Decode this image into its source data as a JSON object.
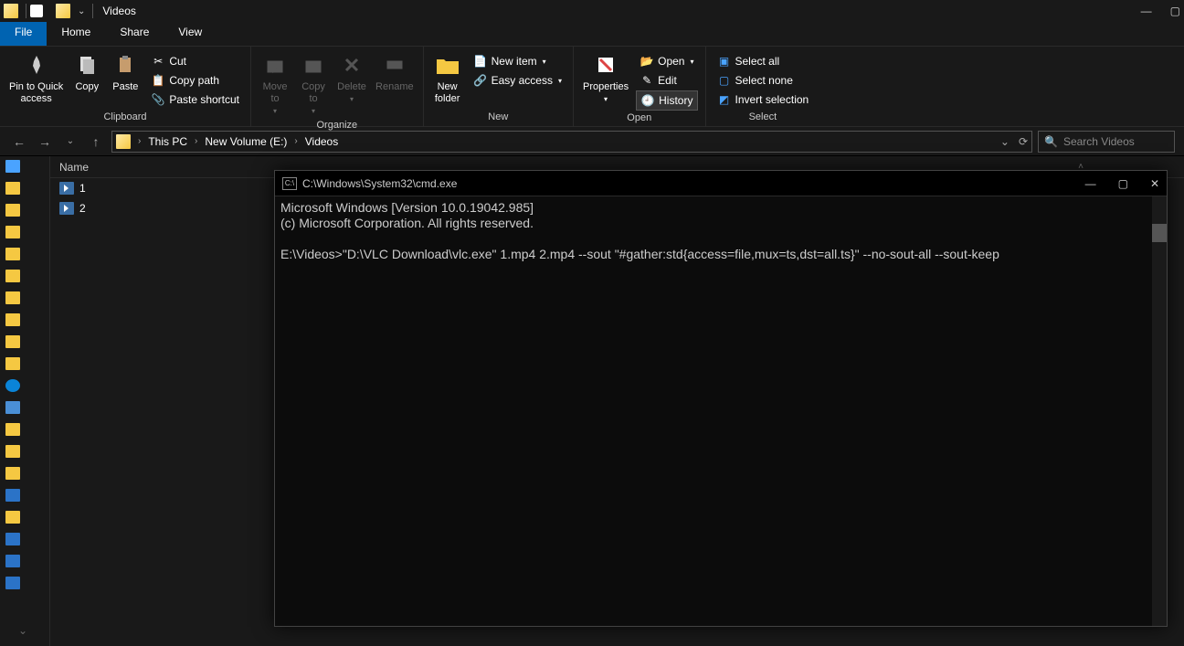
{
  "titlebar": {
    "window_title": "Videos"
  },
  "window_controls": {
    "minimize": "—",
    "maximize": "▢"
  },
  "tabs": {
    "file": "File",
    "home": "Home",
    "share": "Share",
    "view": "View"
  },
  "ribbon": {
    "clipboard": {
      "group_label": "Clipboard",
      "pin": "Pin to Quick\naccess",
      "copy": "Copy",
      "paste": "Paste",
      "cut": "Cut",
      "copy_path": "Copy path",
      "paste_shortcut": "Paste shortcut"
    },
    "organize": {
      "group_label": "Organize",
      "move_to": "Move\nto",
      "copy_to": "Copy\nto",
      "delete": "Delete",
      "rename": "Rename"
    },
    "new": {
      "group_label": "New",
      "new_folder": "New\nfolder",
      "new_item": "New item",
      "easy_access": "Easy access"
    },
    "open": {
      "group_label": "Open",
      "properties": "Properties",
      "open": "Open",
      "edit": "Edit",
      "history": "History"
    },
    "select": {
      "group_label": "Select",
      "select_all": "Select all",
      "select_none": "Select none",
      "invert": "Invert selection"
    }
  },
  "breadcrumb": {
    "items": [
      "This PC",
      "New Volume (E:)",
      "Videos"
    ]
  },
  "search": {
    "placeholder": "Search Videos"
  },
  "file_list": {
    "columns": {
      "name": "Name"
    },
    "files": [
      {
        "name": "1"
      },
      {
        "name": "2"
      }
    ]
  },
  "cmd": {
    "title": "C:\\Windows\\System32\\cmd.exe",
    "lines": {
      "l1": "Microsoft Windows [Version 10.0.19042.985]",
      "l2": "(c) Microsoft Corporation. All rights reserved.",
      "l3": "",
      "l4": "E:\\Videos>\"D:\\VLC Download\\vlc.exe\" 1.mp4 2.mp4 --sout \"#gather:std{access=file,mux=ts,dst=all.ts}\" --no-sout-all --sout-keep"
    },
    "controls": {
      "min": "—",
      "max": "▢",
      "close": "✕"
    }
  }
}
